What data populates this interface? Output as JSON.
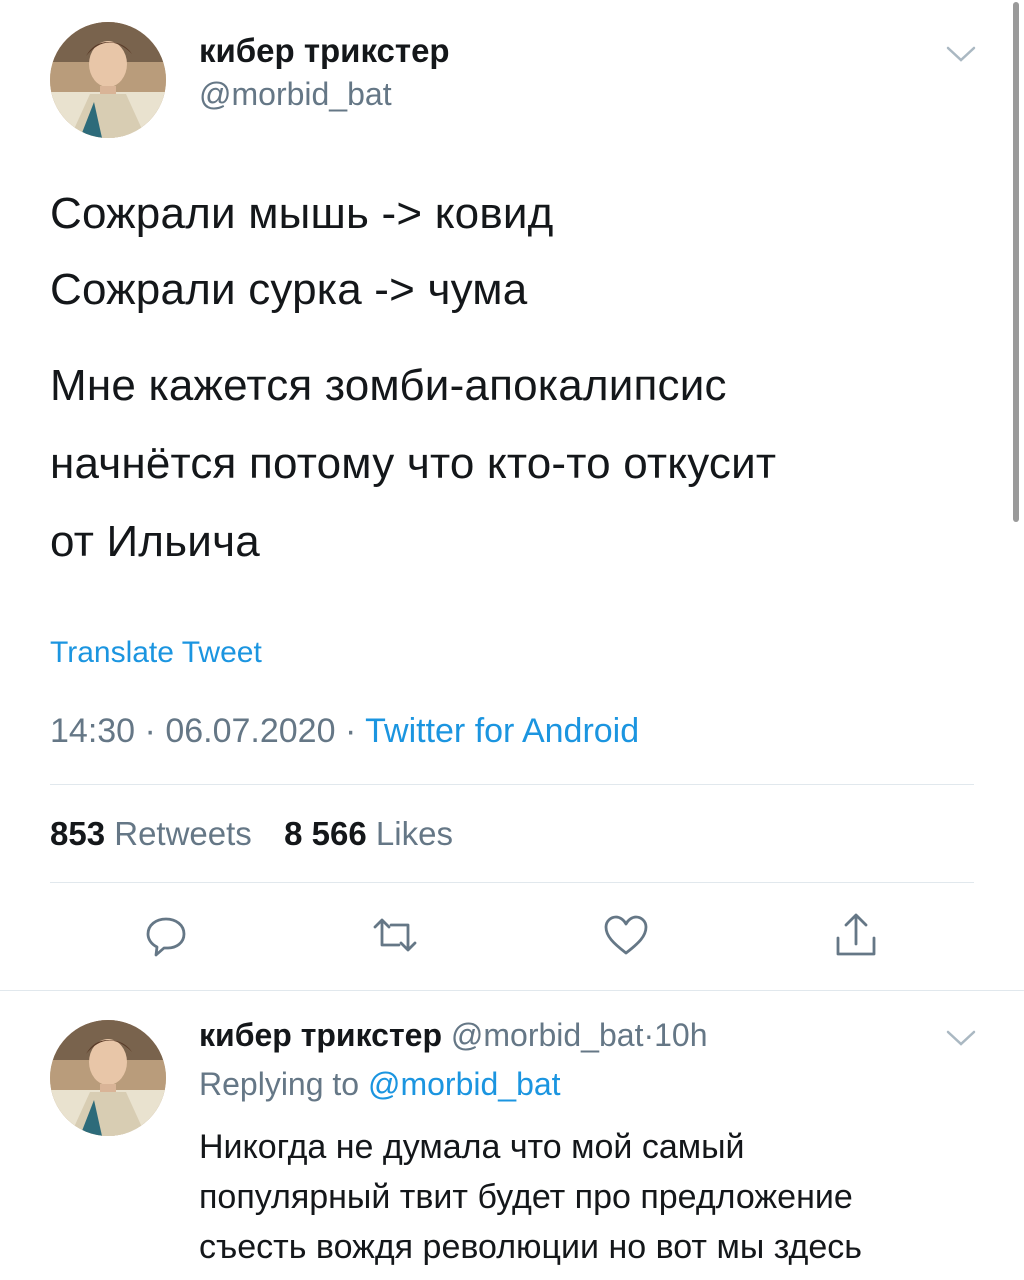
{
  "tweet": {
    "author_name": "кибер трикстер",
    "author_handle": "@morbid_bat",
    "line1": "Сожрали мышь -> ковид",
    "line2": "Сожрали сурка -> чума",
    "para_line1": "Мне кажется зомби-апокалипсис",
    "para_line2": "начнётся потому что кто-то откусит",
    "para_line3": "от Ильича",
    "translate_label": "Translate Tweet",
    "time": "14:30",
    "date": "06.07.2020",
    "source": "Twitter for Android",
    "separator": "·",
    "retweets_count": "853",
    "retweets_label": "Retweets",
    "likes_count": "8 566",
    "likes_label": "Likes"
  },
  "actions": {
    "icons": [
      "reply-icon",
      "retweet-icon",
      "like-icon",
      "share-icon"
    ]
  },
  "reply": {
    "author_name": "кибер трикстер",
    "author_handle": "@morbid_bat",
    "time": "10h",
    "separator": "·",
    "replying_prefix": "Replying to",
    "replying_handle": "@morbid_bat",
    "line1": "Никогда не думала что мой самый",
    "line2": "популярный твит будет про предложение",
    "line3": "съесть вождя революции но вот мы здесь"
  },
  "colors": {
    "accent": "#1b95e0",
    "muted": "#657786",
    "text": "#14171a",
    "divider": "#e1e8ed"
  }
}
